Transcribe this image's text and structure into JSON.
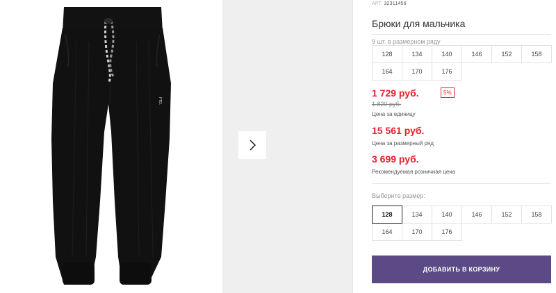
{
  "product": {
    "article_prefix": "АРТ.",
    "article_number": "32311456",
    "title": "Брюки для мальчика",
    "sizes_in_pack_caption": "9 шт. в размерном ряду",
    "pack_sizes": [
      "128",
      "134",
      "140",
      "146",
      "152",
      "158",
      "164",
      "170",
      "176"
    ]
  },
  "pricing": {
    "unit_price": "1 729 руб.",
    "discount_badge": "5%",
    "old_price": "1 820 руб.",
    "unit_price_note": "Цена за единицу",
    "pack_price": "15 561 руб.",
    "pack_price_note": "Цена за размерный ряд",
    "retail_price": "3 699 руб.",
    "retail_price_note": "Рекомендуемая розничная цена"
  },
  "size_selector": {
    "caption": "Выберите размер:",
    "sizes": [
      "128",
      "134",
      "140",
      "146",
      "152",
      "158",
      "164",
      "170",
      "176"
    ],
    "selected": "128"
  },
  "cart": {
    "add_button_label": "ДОБАВИТЬ В КОРЗИНУ"
  },
  "gallery": {
    "garment_print": "FTD."
  },
  "colors": {
    "price_red": "#e2202b",
    "button_purple": "#5c4a86",
    "garment": "#111111"
  }
}
